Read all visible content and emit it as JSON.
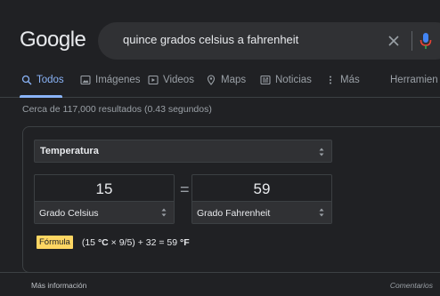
{
  "header": {
    "logo": "Google",
    "search_value": "quince grados celsius a fahrenheit"
  },
  "tabs": [
    {
      "label": "Todos",
      "icon": "search-icon",
      "active": true
    },
    {
      "label": "Imágenes",
      "icon": "image-icon"
    },
    {
      "label": "Videos",
      "icon": "video-icon"
    },
    {
      "label": "Maps",
      "icon": "map-pin-icon"
    },
    {
      "label": "Noticias",
      "icon": "news-icon"
    },
    {
      "label": "Más",
      "icon": "more-vert-icon"
    },
    {
      "label": "Herramien",
      "icon": null
    }
  ],
  "stats": "Cerca de 117,000 resultados (0.43 segundos)",
  "converter": {
    "category": "Temperatura",
    "from_value": "15",
    "from_unit": "Grado Celsius",
    "to_value": "59",
    "to_unit": "Grado Fahrenheit",
    "equals": "=",
    "formula_label": "Fórmula",
    "formula_pre": "(15 ",
    "formula_unit1": "°C",
    "formula_mid": " × 9/5) + 32 = 59 ",
    "formula_unit2": "°F"
  },
  "footer": {
    "more_info": "Más información",
    "feedback": "Comentarios"
  },
  "colors": {
    "background": "#202124",
    "accent": "#8ab4f8",
    "formula_badge": "#fdd663"
  }
}
